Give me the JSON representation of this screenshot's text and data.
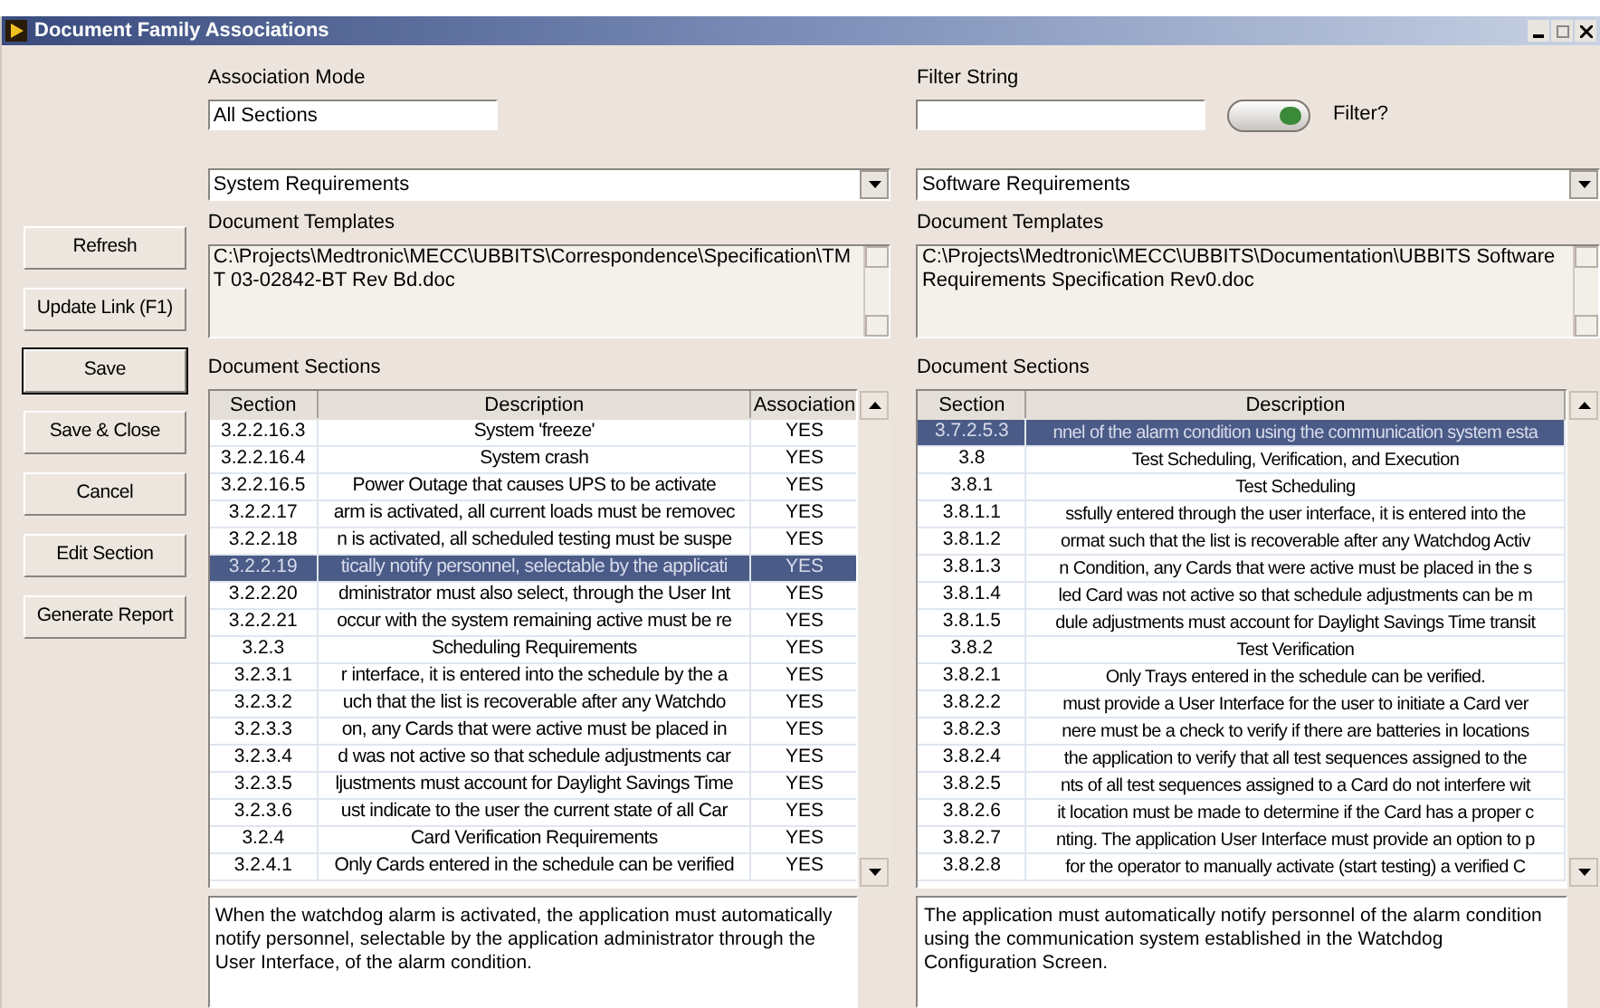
{
  "window": {
    "title": "Document Family Associations"
  },
  "buttons": [
    {
      "label": "Refresh",
      "selected": false
    },
    {
      "label": "Update Link (F1)",
      "selected": false
    },
    {
      "label": "Save",
      "selected": true
    },
    {
      "label": "Save & Close",
      "selected": false
    },
    {
      "label": "Cancel",
      "selected": false
    },
    {
      "label": "Edit Section",
      "selected": false
    },
    {
      "label": "Generate Report",
      "selected": false
    }
  ],
  "left": {
    "mode_label": "Association Mode",
    "mode_value": "All Sections",
    "dropdown": "System Requirements",
    "templates_label": "Document Templates",
    "templates_value": "C:\\Projects\\Medtronic\\MECC\\UBBITS\\Correspondence\\Specification\\TMT 03-02842-BT Rev Bd.doc",
    "sections_label": "Document Sections",
    "columns": [
      "Section",
      "Description",
      "Association"
    ],
    "rows": [
      {
        "section": "3.2.2.16.3",
        "description": "System 'freeze'",
        "association": "YES",
        "selected": false
      },
      {
        "section": "3.2.2.16.4",
        "description": "System crash",
        "association": "YES",
        "selected": false
      },
      {
        "section": "3.2.2.16.5",
        "description": "Power Outage that causes UPS to be activate",
        "association": "YES",
        "selected": false
      },
      {
        "section": "3.2.2.17",
        "description": "arm is activated, all current loads must be removec",
        "association": "YES",
        "selected": false
      },
      {
        "section": "3.2.2.18",
        "description": "n is activated, all scheduled testing must be suspe",
        "association": "YES",
        "selected": false
      },
      {
        "section": "3.2.2.19",
        "description": "tically notify personnel, selectable by the applicati",
        "association": "YES",
        "selected": true
      },
      {
        "section": "3.2.2.20",
        "description": "dministrator must also select, through the User Int",
        "association": "YES",
        "selected": false
      },
      {
        "section": "3.2.2.21",
        "description": "occur with the system remaining active must be re",
        "association": "YES",
        "selected": false
      },
      {
        "section": "3.2.3",
        "description": "Scheduling Requirements",
        "association": "YES",
        "selected": false
      },
      {
        "section": "3.2.3.1",
        "description": "r interface, it is entered into the schedule by the a",
        "association": "YES",
        "selected": false
      },
      {
        "section": "3.2.3.2",
        "description": "uch that the list is recoverable after any Watchdo",
        "association": "YES",
        "selected": false
      },
      {
        "section": "3.2.3.3",
        "description": "on, any Cards that were active must be placed in",
        "association": "YES",
        "selected": false
      },
      {
        "section": "3.2.3.4",
        "description": "d was not active so that schedule adjustments car",
        "association": "YES",
        "selected": false
      },
      {
        "section": "3.2.3.5",
        "description": "ljustments must account for Daylight Savings Time",
        "association": "YES",
        "selected": false
      },
      {
        "section": "3.2.3.6",
        "description": "ust indicate to the user the current state of all Car",
        "association": "YES",
        "selected": false
      },
      {
        "section": "3.2.4",
        "description": "Card Verification Requirements",
        "association": "YES",
        "selected": false
      },
      {
        "section": "3.2.4.1",
        "description": "Only Cards entered in the schedule can be verified",
        "association": "YES",
        "selected": false
      }
    ],
    "detail": "When the watchdog alarm is activated, the application must automatically notify personnel, selectable by the application administrator through the User Interface, of the alarm condition."
  },
  "right": {
    "filter_label": "Filter String",
    "filter_toggle": {
      "label": "Filter?",
      "on": true
    },
    "dropdown": "Software Requirements",
    "templates_label": "Document Templates",
    "templates_value": "C:\\Projects\\Medtronic\\MECC\\UBBITS\\Documentation\\UBBITS Software Requirements Specification Rev0.doc",
    "sections_label": "Document Sections",
    "columns": [
      "Section",
      "Description"
    ],
    "rows": [
      {
        "section": "3.7.2.5.3",
        "description": "nnel of the alarm condition using the communication system esta",
        "selected": true
      },
      {
        "section": "3.8",
        "description": "Test Scheduling, Verification, and Execution",
        "selected": false
      },
      {
        "section": "3.8.1",
        "description": "Test Scheduling",
        "selected": false
      },
      {
        "section": "3.8.1.1",
        "description": "ssfully entered through the user interface, it is entered into the",
        "selected": false
      },
      {
        "section": "3.8.1.2",
        "description": "ormat such that the list is recoverable after any Watchdog Activ",
        "selected": false
      },
      {
        "section": "3.8.1.3",
        "description": "n Condition, any Cards that were active must be placed in the s",
        "selected": false
      },
      {
        "section": "3.8.1.4",
        "description": "led Card was not active so that schedule adjustments can be m",
        "selected": false
      },
      {
        "section": "3.8.1.5",
        "description": "dule adjustments must account for Daylight Savings Time transit",
        "selected": false
      },
      {
        "section": "3.8.2",
        "description": "Test Verification",
        "selected": false
      },
      {
        "section": "3.8.2.1",
        "description": "Only Trays entered in the schedule can be verified.",
        "selected": false
      },
      {
        "section": "3.8.2.2",
        "description": "must provide a User Interface for the user to initiate a Card ver",
        "selected": false
      },
      {
        "section": "3.8.2.3",
        "description": "nere must be a check to verify if there are batteries in locations",
        "selected": false
      },
      {
        "section": "3.8.2.4",
        "description": "the application to verify that all test sequences assigned to the",
        "selected": false
      },
      {
        "section": "3.8.2.5",
        "description": "nts of all test sequences assigned to a Card do not interfere wit",
        "selected": false
      },
      {
        "section": "3.8.2.6",
        "description": "it location must be made to determine if the Card has a proper c",
        "selected": false
      },
      {
        "section": "3.8.2.7",
        "description": "nting. The application User Interface must provide an option to p",
        "selected": false
      },
      {
        "section": "3.8.2.8",
        "description": "for the operator to manually activate (start testing) a verified C",
        "selected": false
      }
    ],
    "detail": "The application must automatically notify personnel of the alarm condition using the communication system established in the Watchdog Configuration Screen."
  }
}
